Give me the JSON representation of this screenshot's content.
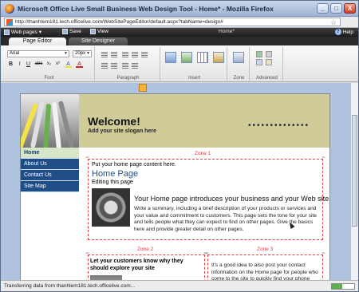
{
  "window": {
    "title": "Microsoft Office Live Small Business Web Design Tool - Home* - Mozilla Firefox",
    "minimize": "_",
    "maximize": "□",
    "close": "X"
  },
  "urlbar": {
    "url": "http://thanhlem181.tech.officelive.com/WebSitePageEditor/default.aspx?tabName=design#",
    "star": "☆"
  },
  "appbar": {
    "web_pages": "Web pages",
    "save": "Save",
    "view": "View",
    "page_name": "Home*",
    "help": "Help"
  },
  "ribbon_tabs": [
    "Page Editor",
    "Site Designer"
  ],
  "ribbon": {
    "font_name": "Arial",
    "font_size": "20px",
    "groups": [
      "Font",
      "Paragraph",
      "Insert",
      "Zone",
      "Advanced"
    ],
    "format_buttons": [
      "B",
      "I",
      "U",
      "abc",
      "x₂",
      "x²",
      "A",
      "A"
    ]
  },
  "site": {
    "welcome": "Welcome!",
    "slogan": "Add your site slogan here",
    "dots": "••••••••••••••",
    "nav": [
      "Home",
      "About Us",
      "Contact Us",
      "Site Map"
    ],
    "zones": {
      "zone1_label": "Zone 1",
      "zone2_label": "Zone 2",
      "zone3_label": "Zone 3",
      "put_content": "Put your home page content here.",
      "heading": "Home Page",
      "editing": "Editing this page",
      "intro": "Your Home page introduces your business and your Web site.",
      "body": "Write a summary, including a brief description of your products or services and your value and commitment to customers. This page sets the tone for your site and tells people what they can expect to find on other pages. Give the basics here and provide greater detail on other pages.",
      "zone2_text": "Let your customers know why they should explore your site",
      "zone3_text": "It's a good idea to also post your contact information on the Home page for people who come to the site to quickly find your phone"
    }
  },
  "status": {
    "text": "Transferring data from thanhlem181.tech.officelive.com...",
    "progress": 0.45
  }
}
